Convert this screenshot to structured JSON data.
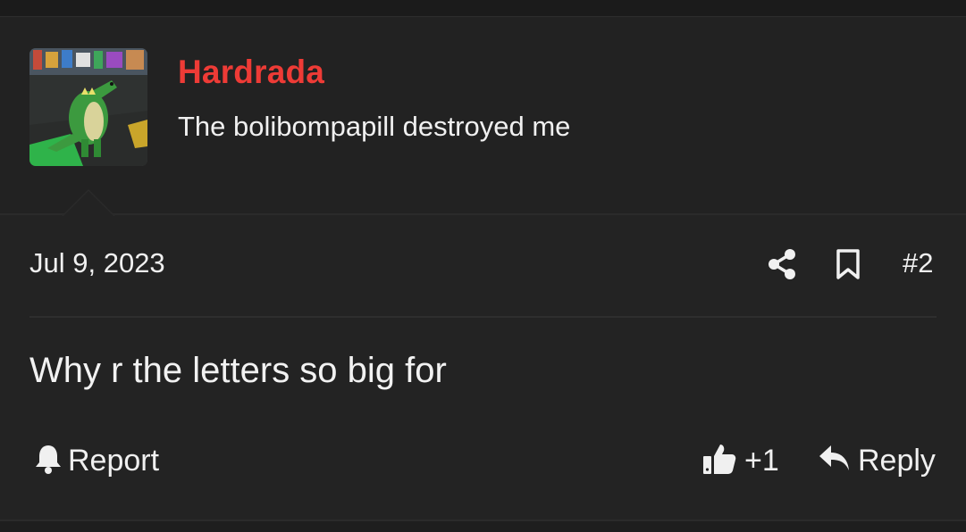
{
  "colors": {
    "background": "#232323",
    "username": "#ee3b36",
    "text": "#f0f0f0",
    "divider": "#2e2e2e"
  },
  "author": {
    "avatar_icon": "dinosaur-avatar-icon",
    "name": "Hardrada",
    "title": "The bolibompapill destroyed me"
  },
  "post": {
    "date": "Jul 9, 2023",
    "number": "#2",
    "body": "Why r the letters so big for"
  },
  "actions": {
    "share_icon": "share-icon",
    "bookmark_icon": "bookmark-icon",
    "report_icon": "bell-icon",
    "report_label": "Report",
    "like_icon": "thumbs-up-icon",
    "like_count": "+1",
    "reply_icon": "reply-icon",
    "reply_label": "Reply"
  }
}
